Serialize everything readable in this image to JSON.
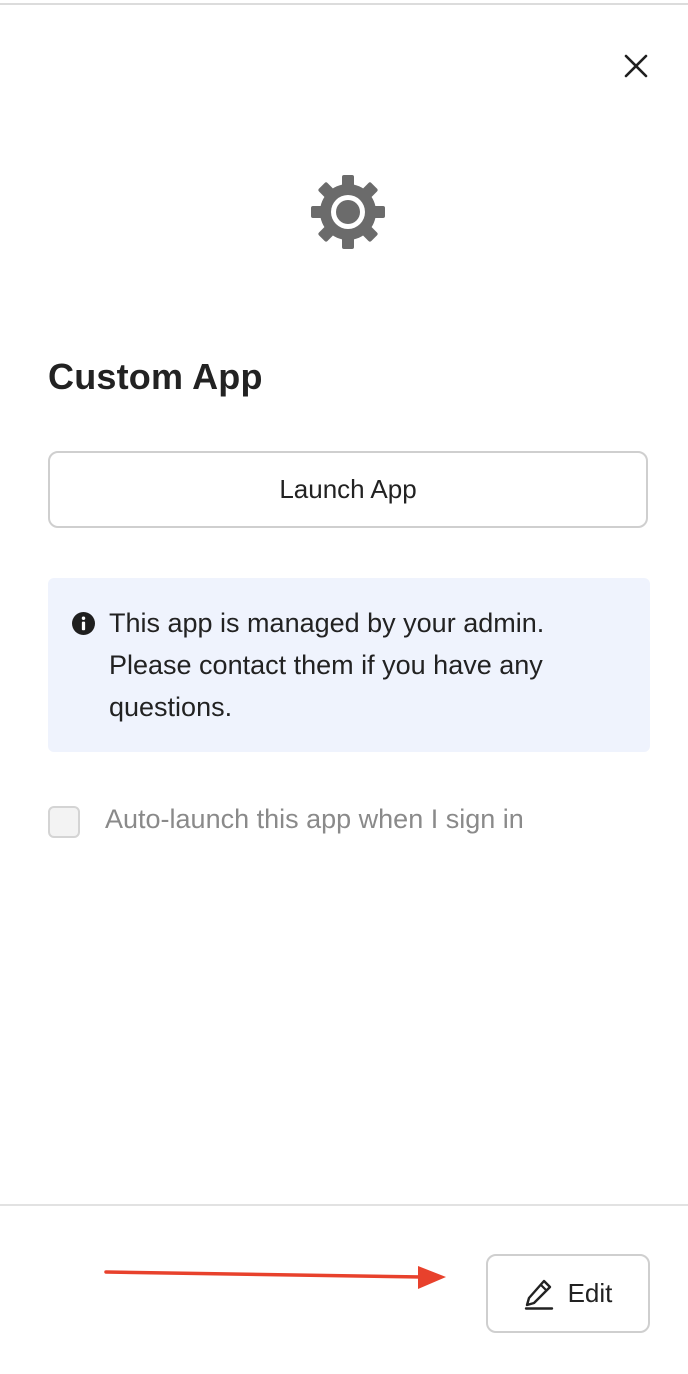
{
  "header": {
    "close_icon": "close-icon",
    "app_icon": "gear-icon"
  },
  "app": {
    "title": "Custom App"
  },
  "actions": {
    "launch_label": "Launch App",
    "edit_label": "Edit",
    "edit_icon": "pencil-icon"
  },
  "notice": {
    "icon": "info-icon",
    "message": "This app is managed by your admin. Please contact them if you have any questions."
  },
  "auto_launch": {
    "label": "Auto-launch this app when I sign in",
    "checked": false
  },
  "annotation": {
    "arrow_color": "#e8412c"
  },
  "colors": {
    "notice_bg": "#eff3fd",
    "icon_gray": "#6b6b6b"
  }
}
